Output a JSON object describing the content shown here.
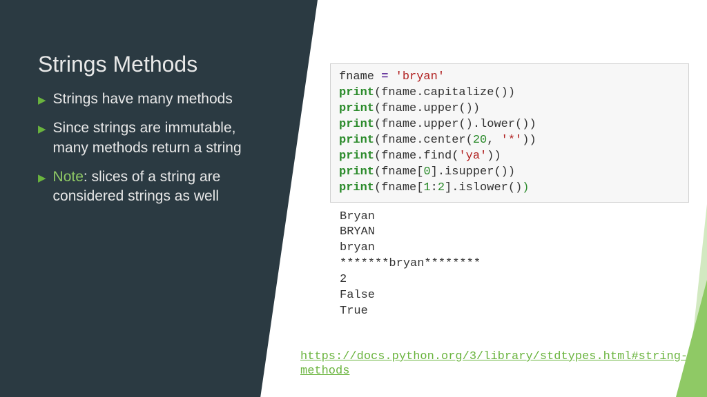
{
  "title": "Strings Methods",
  "bullets": [
    {
      "text": "Strings have many methods"
    },
    {
      "text": "Since strings are immutable, many methods return a string"
    },
    {
      "note": "Note",
      "text": ": slices of a string are considered strings as well"
    }
  ],
  "code": {
    "l1_var": "fname ",
    "l1_op": "=",
    "l1_str": " 'bryan'",
    "l2_kw": "print",
    "l2_rest": "(fname.capitalize())",
    "l3_kw": "print",
    "l3_rest": "(fname.upper())",
    "l4_kw": "print",
    "l4_rest": "(fname.upper().lower())",
    "l5_kw": "print",
    "l5_a": "(fname.center(",
    "l5_num": "20",
    "l5_b": ", ",
    "l5_str": "'*'",
    "l5_c": "))",
    "l6_kw": "print",
    "l6_a": "(fname.find(",
    "l6_str": "'ya'",
    "l6_b": "))",
    "l7_kw": "print",
    "l7_a": "(fname[",
    "l7_num": "0",
    "l7_b": "].isupper())",
    "l8_kw": "print",
    "l8_a": "(fname[",
    "l8_n1": "1",
    "l8_colon": ":",
    "l8_n2": "2",
    "l8_b": "].islower()",
    "l8_close": ")"
  },
  "output": "Bryan\nBRYAN\nbryan\n*******bryan********\n2\nFalse\nTrue",
  "link": "https://docs.python.org/3/library/stdtypes.html#string-methods"
}
